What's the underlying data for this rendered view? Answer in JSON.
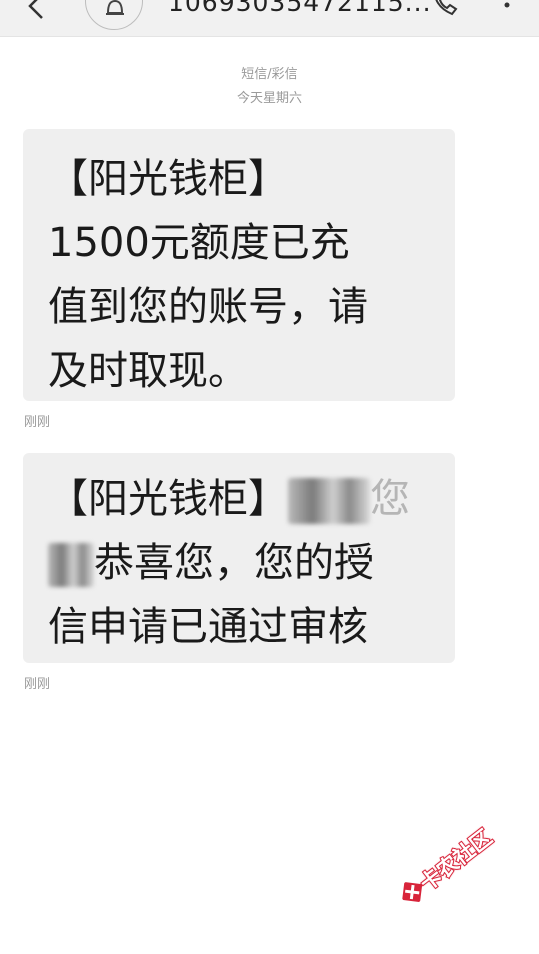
{
  "header": {
    "phone_number": "10693035472115...",
    "icons": {
      "back": "back-arrow-icon",
      "bell": "bell-icon",
      "call": "phone-call-icon",
      "more": "more-vertical-icon"
    }
  },
  "conversation": {
    "message_type": "短信/彩信",
    "date_label": "今天星期六",
    "messages": [
      {
        "lines": [
          "【阳光钱柜】",
          "1500元额度已充",
          "值到您的账号，请",
          "及时取现。"
        ],
        "time": "刚刚"
      },
      {
        "line1_start": "【阳光钱柜】",
        "line1_end": "您",
        "line2_end": "恭喜您，您的授",
        "line3": "信申请已通过审核",
        "time": "刚刚"
      }
    ]
  },
  "watermark": {
    "text": "卡农社区",
    "color": "#d8243a"
  }
}
